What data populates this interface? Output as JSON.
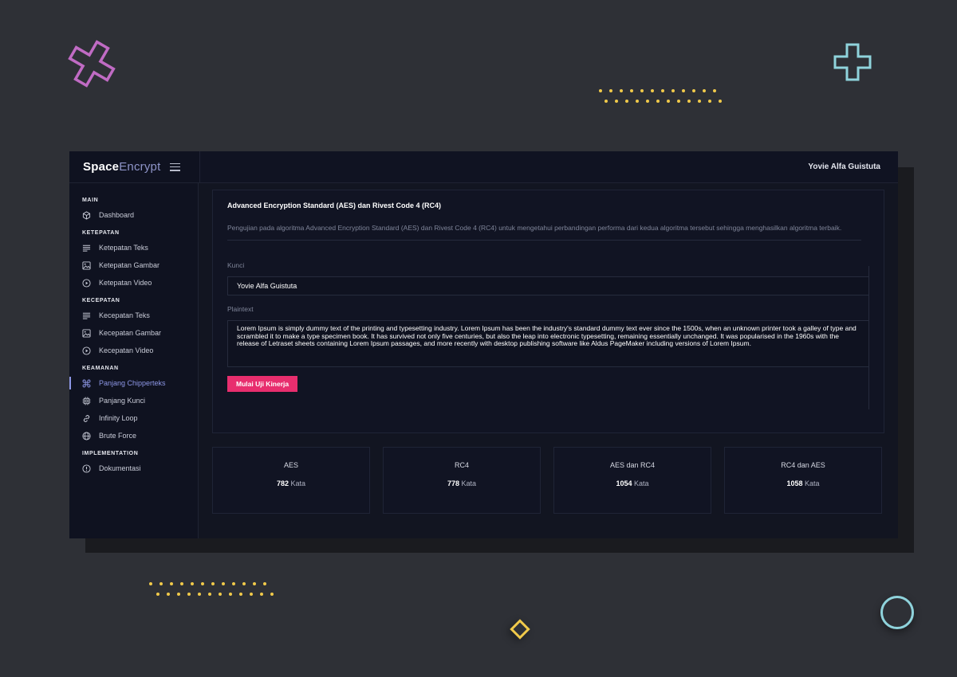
{
  "brand": {
    "bold": "Space",
    "light": "Encrypt"
  },
  "header": {
    "user": "Yovie Alfa Guistuta"
  },
  "sidebar": {
    "sections": [
      {
        "title": "MAIN",
        "items": [
          {
            "label": "Dashboard",
            "icon": "cube-icon"
          }
        ]
      },
      {
        "title": "KETEPATAN",
        "items": [
          {
            "label": "Ketepatan Teks",
            "icon": "text-lines-icon"
          },
          {
            "label": "Ketepatan Gambar",
            "icon": "image-icon"
          },
          {
            "label": "Ketepatan Video",
            "icon": "play-circle-icon"
          }
        ]
      },
      {
        "title": "KECEPATAN",
        "items": [
          {
            "label": "Kecepatan Teks",
            "icon": "text-lines-icon"
          },
          {
            "label": "Kecepatan Gambar",
            "icon": "image-icon"
          },
          {
            "label": "Kecepatan Video",
            "icon": "play-circle-icon"
          }
        ]
      },
      {
        "title": "KEAMANAN",
        "items": [
          {
            "label": "Panjang Chipperteks",
            "icon": "command-icon",
            "active": true
          },
          {
            "label": "Panjang Kunci",
            "icon": "cpu-icon"
          },
          {
            "label": "Infinity Loop",
            "icon": "link-icon"
          },
          {
            "label": "Brute Force",
            "icon": "globe-icon"
          }
        ]
      },
      {
        "title": "IMPLEMENTATION",
        "items": [
          {
            "label": "Dokumentasi",
            "icon": "info-circle-icon"
          }
        ]
      }
    ]
  },
  "card": {
    "title": "Advanced Encryption Standard (AES) dan Rivest Code 4 (RC4)",
    "description": "Pengujian pada algoritma Advanced Encryption Standard (AES) dan Rivest Code 4 (RC4) untuk mengetahui perbandingan performa dari kedua algoritma tersebut sehingga menghasilkan algoritma terbaik."
  },
  "form": {
    "key_label": "Kunci",
    "key_value": "Yovie Alfa Guistuta",
    "plaintext_label": "Plaintext",
    "plaintext_value": "Lorem Ipsum is simply dummy text of the printing and typesetting industry. Lorem Ipsum has been the industry's standard dummy text ever since the 1500s, when an unknown printer took a galley of type and scrambled it to make a type specimen book. It has survived not only five centuries, but also the leap into electronic typesetting, remaining essentially unchanged. It was popularised in the 1960s with the release of Letraset sheets containing Lorem Ipsum passages, and more recently with desktop publishing software like Aldus PageMaker including versions of Lorem Ipsum.",
    "submit_label": "Mulai Uji Kinerja"
  },
  "stats": [
    {
      "title": "AES",
      "value": "782",
      "unit": "Kata"
    },
    {
      "title": "RC4",
      "value": "778",
      "unit": "Kata"
    },
    {
      "title": "AES dan RC4",
      "value": "1054",
      "unit": "Kata"
    },
    {
      "title": "RC4 dan AES",
      "value": "1058",
      "unit": "Kata"
    }
  ],
  "colors": {
    "accent": "#e82e6e",
    "active_nav": "#8d97e6",
    "background": "#2e3036",
    "panel": "#121521"
  }
}
